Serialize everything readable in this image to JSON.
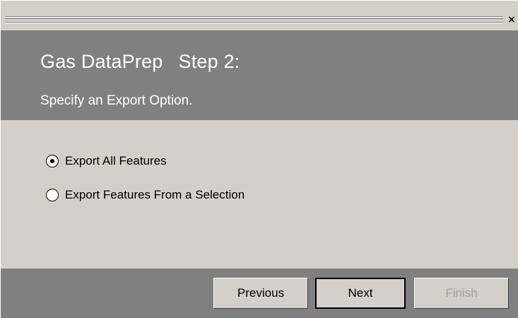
{
  "window": {
    "close_glyph": "×"
  },
  "header": {
    "title": "Gas DataPrep",
    "step": "Step 2:",
    "subtitle": "Specify an Export Option."
  },
  "options": [
    {
      "label": "Export All Features",
      "selected": true
    },
    {
      "label": "Export Features From a Selection",
      "selected": false
    }
  ],
  "buttons": {
    "previous": "Previous",
    "next": "Next",
    "finish": "Finish",
    "finish_enabled": false
  },
  "colors": {
    "header_bg": "#808080",
    "body_bg": "#d4d0c8",
    "disabled_text": "#a0a0a0"
  }
}
